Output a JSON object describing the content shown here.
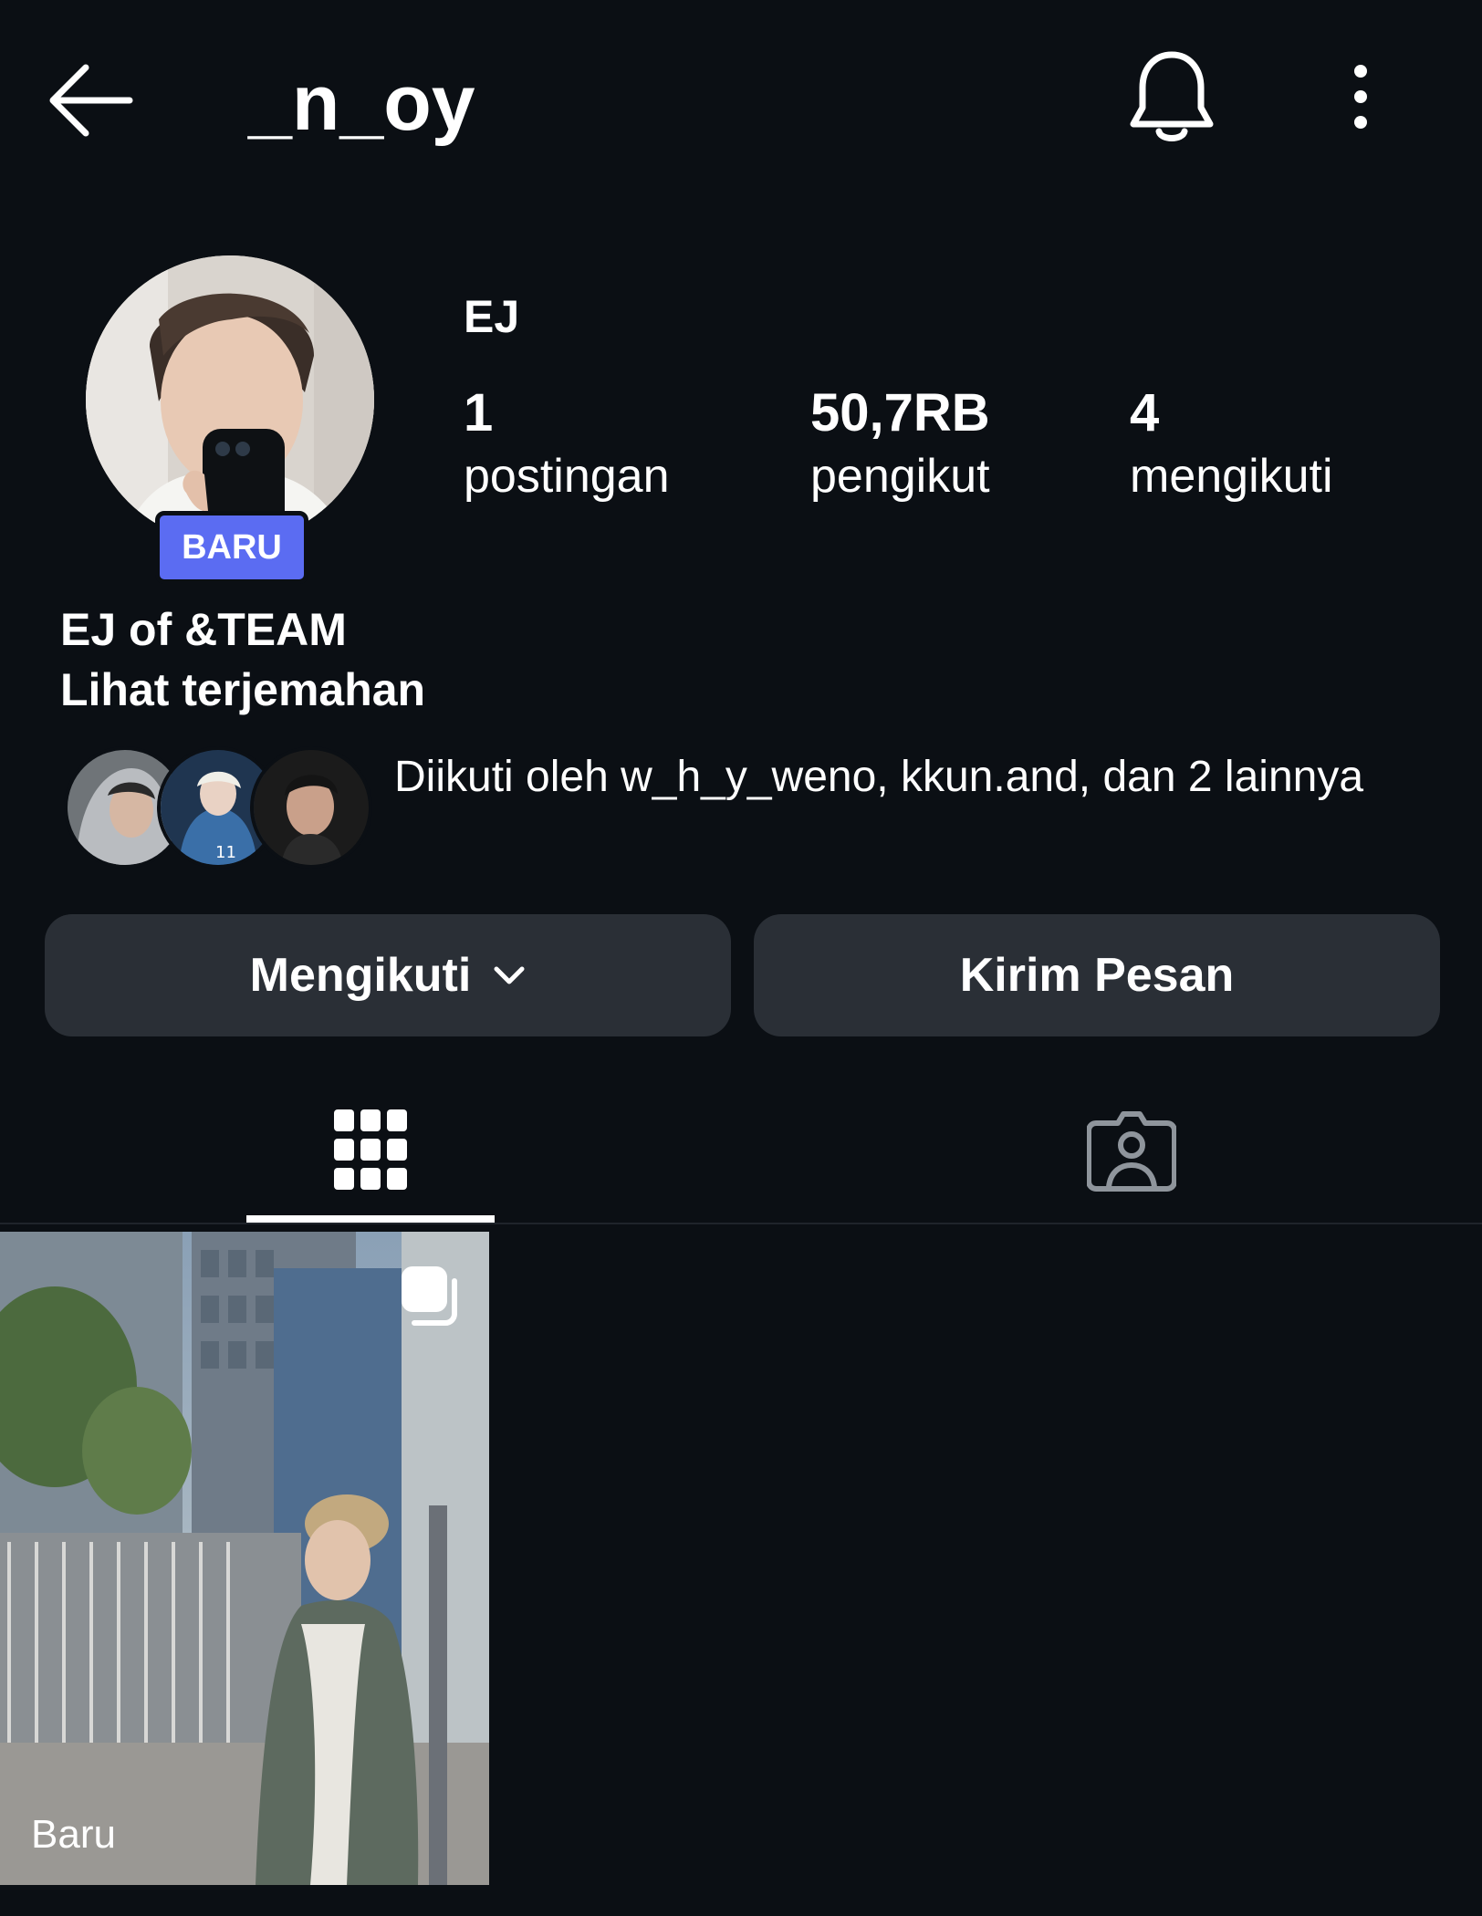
{
  "header": {
    "username": "_n_oy",
    "back_icon": "arrow-left-icon",
    "bell_icon": "bell-icon",
    "more_icon": "more-vertical-icon"
  },
  "profile": {
    "display_name": "EJ",
    "badge": "BARU",
    "stats": {
      "posts_count": "1",
      "posts_label": "postingan",
      "followers_count": "50,7RB",
      "followers_label": "pengikut",
      "following_count": "4",
      "following_label": "mengikuti"
    },
    "bio": "EJ of &TEAM",
    "translate_link": "Lihat terjemahan",
    "followed_by_text": "Diikuti oleh w_h_y_weno, kkun.and, dan 2 lainnya"
  },
  "actions": {
    "following_button": "Mengikuti",
    "message_button": "Kirim Pesan"
  },
  "tabs": {
    "grid_icon": "grid-icon",
    "tagged_icon": "tagged-person-icon",
    "active": "grid"
  },
  "posts": [
    {
      "label": "Baru",
      "icon": "multi-post-icon"
    }
  ],
  "colors": {
    "background": "#0b0f14",
    "button": "#2a2f36",
    "badge": "#5b6cf2",
    "text": "#ffffff"
  }
}
